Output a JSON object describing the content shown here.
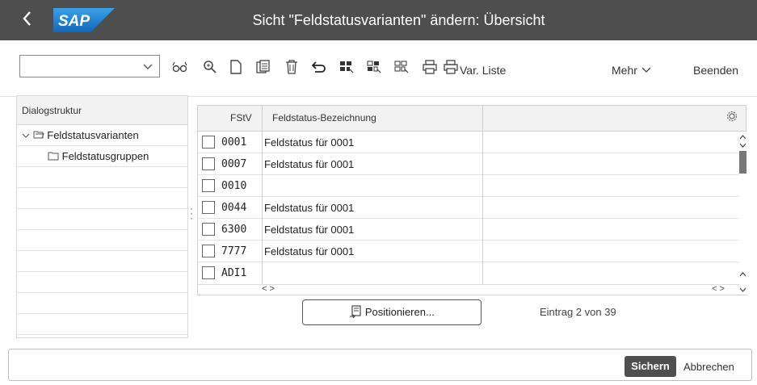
{
  "header": {
    "back_icon": "chevron-left-icon",
    "logo": "SAP",
    "title": "Sicht \"Feldstatusvarianten\" ändern: Übersicht"
  },
  "toolbar": {
    "command_field": "",
    "icons": [
      "glasses-icon",
      "search-icon",
      "new-document-icon",
      "copy-icon",
      "delete-icon",
      "undo-icon",
      "select-all-icon",
      "select-block-icon",
      "deselect-all-icon",
      "print-icon"
    ],
    "var_liste_label": "Var. Liste",
    "mehr_label": "Mehr",
    "beenden_label": "Beenden"
  },
  "nav": {
    "header": "Dialogstruktur",
    "items": [
      {
        "label": "Feldstatusvarianten",
        "icon": "folder-open-icon",
        "expanded": true
      },
      {
        "label": "Feldstatusgruppen",
        "icon": "folder-icon"
      }
    ]
  },
  "table": {
    "col_key": "FStV",
    "col_desc": "Feldstatus-Bezeichnung",
    "rows": [
      {
        "key": "0001",
        "desc": "Feldstatus für 0001"
      },
      {
        "key": "0007",
        "desc": "Feldstatus für 0001"
      },
      {
        "key": "0010",
        "desc": ""
      },
      {
        "key": "0044",
        "desc": "Feldstatus für 0001"
      },
      {
        "key": "6300",
        "desc": "Feldstatus für 0001"
      },
      {
        "key": "7777",
        "desc": "Feldstatus für 0001"
      },
      {
        "key": "ADI1",
        "desc": ""
      }
    ],
    "hscroll_left": "< >",
    "hscroll_right": "< >"
  },
  "position_button": "Positionieren...",
  "entry_info": "Eintrag 2 von 39",
  "footer": {
    "save_label": "Sichern",
    "cancel_label": "Abbrechen"
  },
  "colors": {
    "title_bar": "#4e4e4e",
    "save_button": "#4f4f4f",
    "logo_blue": "#1f74c8"
  }
}
